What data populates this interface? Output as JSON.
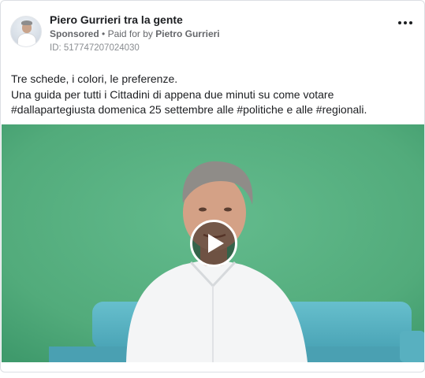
{
  "post": {
    "page_name": "Piero Gurrieri tra la gente",
    "sponsored_label": "Sponsored",
    "separator": "•",
    "paid_for_label": "Paid for by",
    "payer": "Pietro Gurrieri",
    "ad_id": "ID: 517747207024030",
    "more_icon": "more-horizontal-icon"
  },
  "body": {
    "lines": [
      "Tre schede, i colori, le preferenze.",
      "Una guida per tutti i Cittadini di appena due minuti su come votare",
      "#dallapartegiusta domenica 25 settembre alle #politiche e alle #regionali."
    ]
  },
  "video": {
    "play_icon": "play-icon",
    "background_color": "#56b180",
    "sofa_color": "#5bb6c6"
  }
}
